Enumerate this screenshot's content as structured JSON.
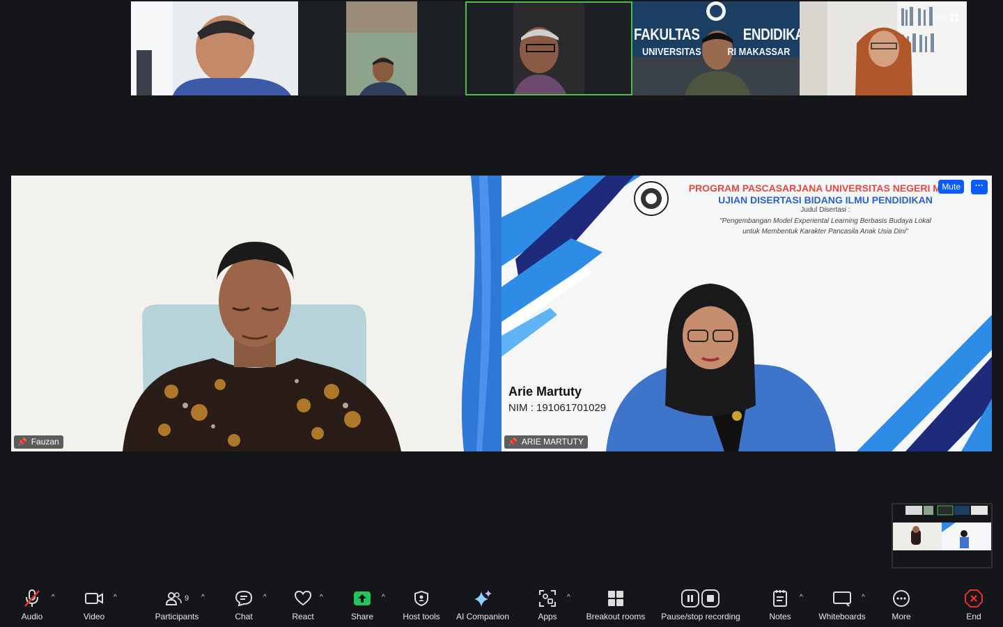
{
  "top_bar": {
    "view_label": "ew"
  },
  "filmstrip": [
    {
      "id": "p1",
      "active": false
    },
    {
      "id": "p2",
      "active": false
    },
    {
      "id": "p3",
      "active": true
    },
    {
      "id": "p4",
      "active": false,
      "backdrop_line1": "FAKULTAS",
      "backdrop_line1b": "ENDIDIKAN",
      "backdrop_line2": "UNIVERSITAS",
      "backdrop_line2b": "RI MAKASSAR"
    },
    {
      "id": "p5",
      "active": false
    }
  ],
  "main_videos": {
    "left": {
      "name": "Fauzan"
    },
    "right": {
      "name": "ARIE MARTUTY",
      "mute_label": "Mute",
      "more_label": "···",
      "slide": {
        "line1": "PROGRAM PASCASARJANA UNIVERSITAS NEGERI MAKA",
        "line2": "UJIAN DISERTASI BIDANG ILMU PENDIDIKAN",
        "line3": "Judul Disertasi :",
        "line4a": "\"Pengembangan Model Experiental Learning Berbasis Budaya Lokal",
        "line4b": "untuk Membentuk Karakter Pancasila Anak Usia Dini\"",
        "presenter": "Arie Martuty",
        "nim": "NIM : 191061701029"
      }
    }
  },
  "toolbar": {
    "audio": "Audio",
    "video": "Video",
    "participants": "Participants",
    "participants_count": "9",
    "chat": "Chat",
    "react": "React",
    "share": "Share",
    "host_tools": "Host tools",
    "ai_companion": "AI Companion",
    "apps": "Apps",
    "breakout_rooms": "Breakout rooms",
    "recording": "Pause/stop recording",
    "notes": "Notes",
    "whiteboards": "Whiteboards",
    "more": "More",
    "end": "End"
  },
  "colors": {
    "background": "#141619",
    "active_speaker": "#4fbf4a",
    "mute_button": "#0b5cff",
    "share_green": "#22c55e",
    "end_red": "#e5302b"
  }
}
